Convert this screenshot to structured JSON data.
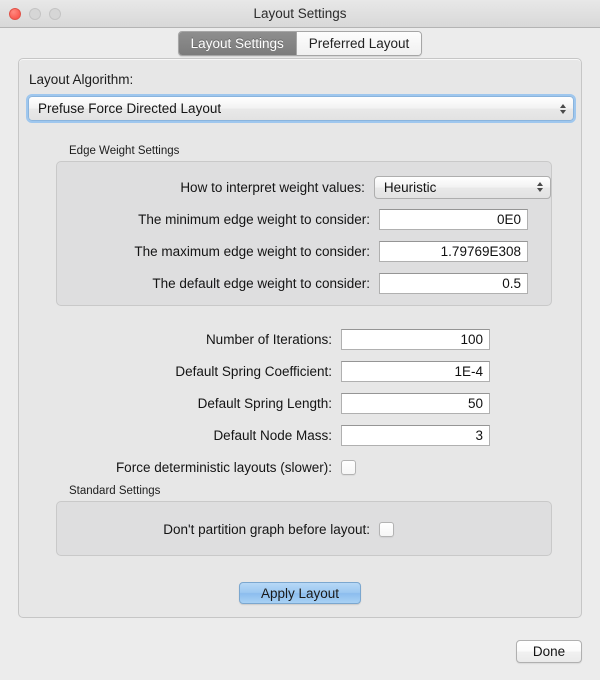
{
  "window": {
    "title": "Layout Settings",
    "controls": {
      "close": "close-button",
      "minimize": "minimize-button",
      "zoom": "zoom-button"
    }
  },
  "tabs": [
    {
      "label": "Layout Settings",
      "active": true
    },
    {
      "label": "Preferred Layout",
      "active": false
    }
  ],
  "algorithm": {
    "label": "Layout Algorithm:",
    "value": "Prefuse Force Directed Layout"
  },
  "edge_weight_group": {
    "title": "Edge Weight Settings",
    "rows": [
      {
        "label": "How to interpret weight values:",
        "value": "Heuristic",
        "control": "combo"
      },
      {
        "label": "The minimum edge weight to consider:",
        "value": "0E0",
        "control": "text"
      },
      {
        "label": "The maximum edge weight to consider:",
        "value": "1.79769E308",
        "control": "text"
      },
      {
        "label": "The default edge weight to consider:",
        "value": "0.5",
        "control": "text"
      }
    ]
  },
  "force_rows": [
    {
      "label": "Number of Iterations:",
      "value": "100",
      "control": "text"
    },
    {
      "label": "Default Spring Coefficient:",
      "value": "1E-4",
      "control": "text"
    },
    {
      "label": "Default Spring Length:",
      "value": "50",
      "control": "text"
    },
    {
      "label": "Default Node Mass:",
      "value": "3",
      "control": "text"
    },
    {
      "label": "Force deterministic layouts (slower):",
      "value": "",
      "control": "checkbox",
      "checked": false
    }
  ],
  "standard_group": {
    "title": "Standard Settings",
    "rows": [
      {
        "label": "Don't partition graph before layout:",
        "value": "",
        "control": "checkbox",
        "checked": false
      }
    ]
  },
  "buttons": {
    "apply": "Apply Layout",
    "done": "Done"
  },
  "colors": {
    "window_bg": "#ececec",
    "panel_bg": "#e7e7e7",
    "group_bg": "#dededf",
    "accent_button": "#9cc8f1",
    "focus_ring": "#9fc7ee",
    "active_tab": "#7c7c7c",
    "close_light": "#fb5b52"
  }
}
